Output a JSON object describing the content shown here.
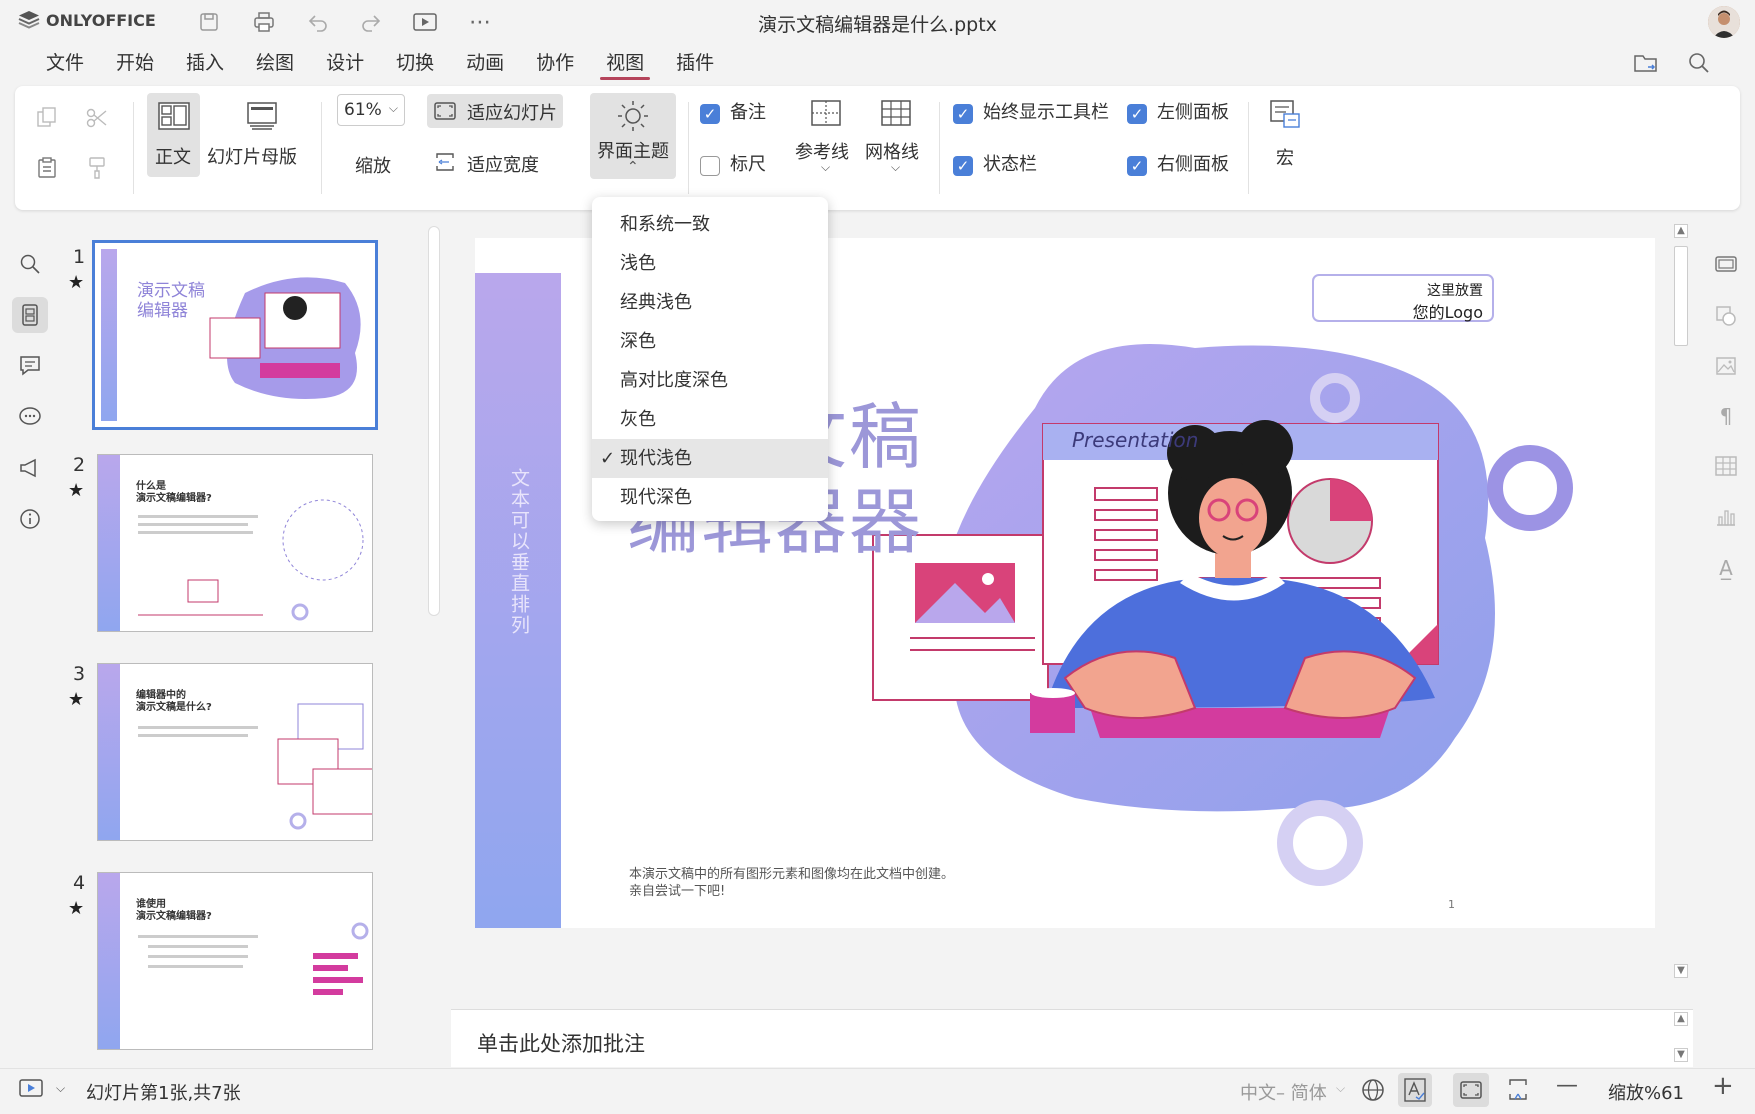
{
  "app": {
    "brand": "ONLYOFFICE",
    "doc_title": "演示文稿编辑器是什么.pptx"
  },
  "menu": {
    "tabs": [
      "文件",
      "开始",
      "插入",
      "绘图",
      "设计",
      "切换",
      "动画",
      "协作",
      "视图",
      "插件"
    ],
    "active": "视图"
  },
  "ribbon": {
    "normal": "正文",
    "master": "幻灯片母版",
    "zoom_value": "61%",
    "zoom": "缩放",
    "fit_slide": "适应幻灯片",
    "fit_width": "适应宽度",
    "theme": "界面主题",
    "notes": "备注",
    "ruler": "标尺",
    "guides": "参考线",
    "gridlines": "网格线",
    "always_toolbar": "始终显示工具栏",
    "statusbar": "状态栏",
    "left_panel": "左侧面板",
    "right_panel": "右侧面板",
    "macros": "宏"
  },
  "checks": {
    "notes": true,
    "ruler": false,
    "always_toolbar": true,
    "statusbar": true,
    "left_panel": true,
    "right_panel": true
  },
  "theme_menu": {
    "options": [
      "和系统一致",
      "浅色",
      "经典浅色",
      "深色",
      "高对比度深色",
      "灰色",
      "现代浅色",
      "现代深色"
    ],
    "selected": "现代浅色"
  },
  "thumbnails": [
    {
      "num": "1",
      "title": "演示文稿\n编辑器"
    },
    {
      "num": "2",
      "title": "什么是\n演示文稿编辑器?"
    },
    {
      "num": "3",
      "title": "编辑器中的\n演示文稿是什么?"
    },
    {
      "num": "4",
      "title": "谁使用\n演示文稿编辑器?"
    }
  ],
  "slide": {
    "vertical_text": "文本可以垂直排列",
    "title_line1": "演示文稿",
    "title_line2": "编辑器器",
    "logo_line1": "这里放置",
    "logo_line2": "您的Logo",
    "presentation_label": "Presentation",
    "footer_line1": "本演示文稿中的所有图形元素和图像均在此文档中创建。",
    "footer_line2": "亲自尝试一下吧!",
    "page_num": "1"
  },
  "notes_placeholder": "单击此处添加批注",
  "status": {
    "slide_count": "幻灯片第1张,共7张",
    "language": "中文– 简体",
    "zoom": "缩放%61"
  },
  "colors": {
    "accent": "#b5445b",
    "check": "#4a7fd8",
    "slide_purple": "#9c8fe0",
    "slide_pink": "#d9437a"
  }
}
